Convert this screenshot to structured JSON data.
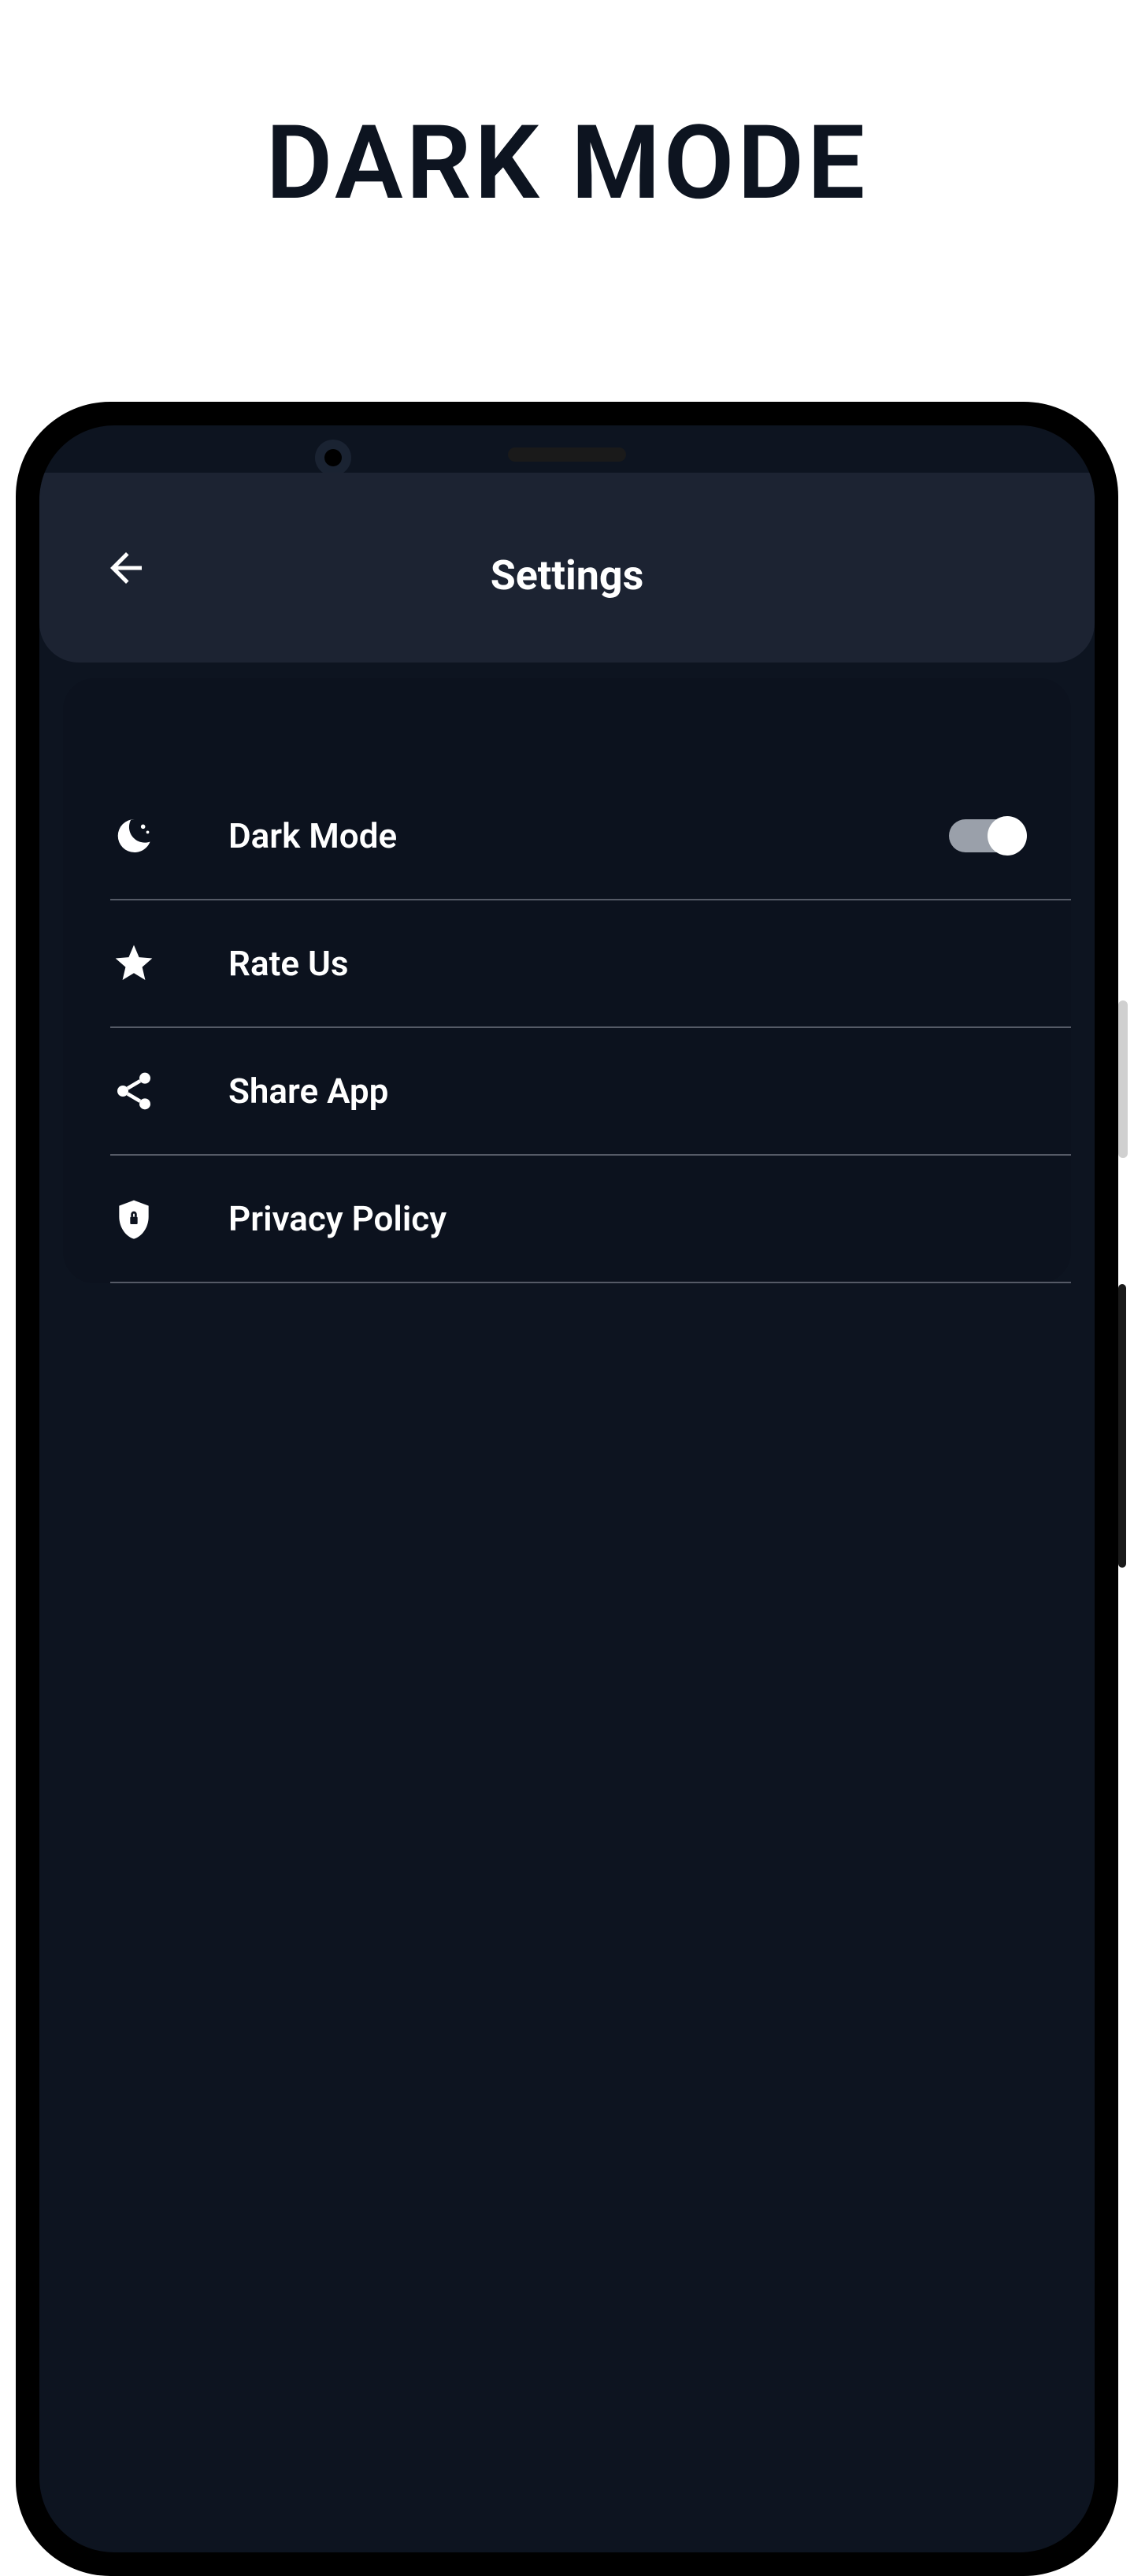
{
  "promo": {
    "title": "DARK MODE"
  },
  "header": {
    "title": "Settings"
  },
  "settings": {
    "items": [
      {
        "label": "Dark Mode",
        "icon": "moon-icon",
        "toggle_on": true
      },
      {
        "label": "Rate Us",
        "icon": "star-icon"
      },
      {
        "label": "Share App",
        "icon": "share-icon"
      },
      {
        "label": "Privacy Policy",
        "icon": "shield-icon"
      }
    ]
  },
  "colors": {
    "page_bg": "#ffffff",
    "phone_shell": "#000000",
    "screen_bg": "#0d1420",
    "header_bg": "#1c2332",
    "card_bg": "#0c121e",
    "text_primary": "#ffffff",
    "divider": "#555a66",
    "toggle_track": "#9aa0aa",
    "toggle_knob": "#ffffff"
  }
}
